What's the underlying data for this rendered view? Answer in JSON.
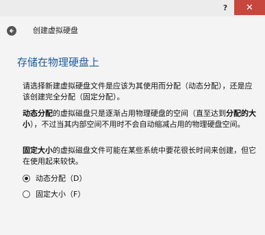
{
  "titlebar": {
    "help_label": "?",
    "close_label": "✕"
  },
  "navbar": {
    "back_icon": "back-arrow-icon",
    "title": "创建虚拟硬盘"
  },
  "page": {
    "title": "存储在物理硬盘上",
    "intro": "请选择新建虚拟硬盘文件是应该为其使用而分配（动态分配），还是应该创建完全分配（固定分配）。",
    "dynamic_label": "动态分配",
    "dynamic_desc_1": "的虚拟磁盘只是逐渐占用物理硬盘的空间（直至达到",
    "dynamic_max": "分配的大小",
    "dynamic_desc_2": "），不过当其内部空间不用时不会自动缩减占用的物理硬盘空间。",
    "fixed_label": "固定大小",
    "fixed_desc": "的虚拟磁盘文件可能在某些系统中要花很长时间来创建，但它在使用起来较快。"
  },
  "options": [
    {
      "label": "动态分配（D）",
      "selected": true
    },
    {
      "label": "固定大小（F）",
      "selected": false
    }
  ],
  "colors": {
    "title_blue": "#1c5a9e",
    "close_red": "#c7463d"
  }
}
